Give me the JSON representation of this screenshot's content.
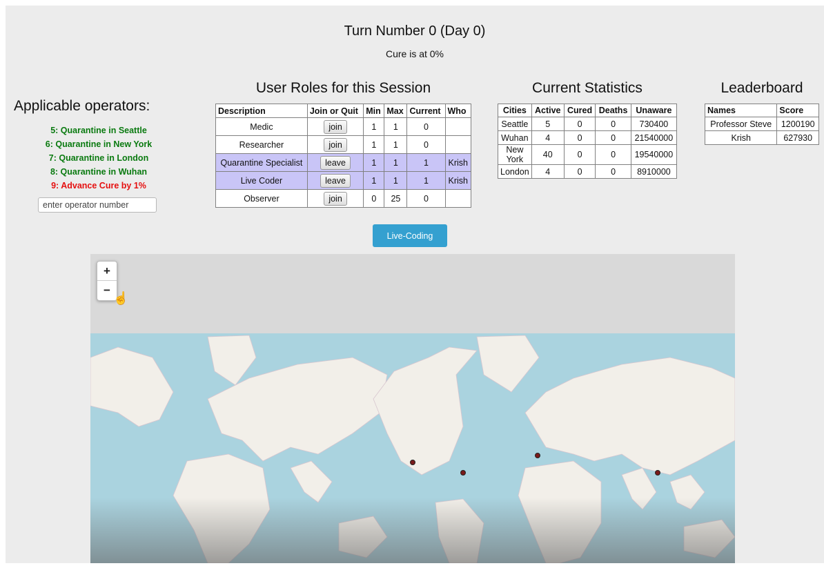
{
  "header": {
    "turn": "Turn Number 0 (Day 0)",
    "cure": "Cure is at 0%"
  },
  "operators": {
    "title": "Applicable operators:",
    "items": [
      {
        "label": "5: Quarantine in Seattle",
        "color": "#0a7a10"
      },
      {
        "label": "6: Quarantine in New York",
        "color": "#0a7a10"
      },
      {
        "label": "7: Quarantine in London",
        "color": "#0a7a10"
      },
      {
        "label": "8: Quarantine in Wuhan",
        "color": "#0a7a10"
      },
      {
        "label": "9: Advance Cure by 1%",
        "color": "#e51010"
      }
    ],
    "input_placeholder": "enter operator number"
  },
  "roles": {
    "title": "User Roles for this Session",
    "headers": [
      "Description",
      "Join or Quit",
      "Min",
      "Max",
      "Current",
      "Who"
    ],
    "rows": [
      {
        "description": "Medic",
        "action": "join",
        "min": "1",
        "max": "1",
        "current": "0",
        "who": ""
      },
      {
        "description": "Researcher",
        "action": "join",
        "min": "1",
        "max": "1",
        "current": "0",
        "who": ""
      },
      {
        "description": "Quarantine Specialist",
        "action": "leave",
        "min": "1",
        "max": "1",
        "current": "1",
        "who": "Krish"
      },
      {
        "description": "Live Coder",
        "action": "leave",
        "min": "1",
        "max": "1",
        "current": "1",
        "who": "Krish"
      },
      {
        "description": "Observer",
        "action": "join",
        "min": "0",
        "max": "25",
        "current": "0",
        "who": ""
      }
    ]
  },
  "stats": {
    "title": "Current Statistics",
    "headers": [
      "Cities",
      "Active",
      "Cured",
      "Deaths",
      "Unaware"
    ],
    "rows": [
      {
        "city": "Seattle",
        "active": "5",
        "cured": "0",
        "deaths": "0",
        "unaware": "730400"
      },
      {
        "city": "Wuhan",
        "active": "4",
        "cured": "0",
        "deaths": "0",
        "unaware": "21540000"
      },
      {
        "city": "New York",
        "active": "40",
        "cured": "0",
        "deaths": "0",
        "unaware": "19540000"
      },
      {
        "city": "London",
        "active": "4",
        "cured": "0",
        "deaths": "0",
        "unaware": "8910000"
      }
    ]
  },
  "leaderboard": {
    "title": "Leaderboard",
    "headers": [
      "Names",
      "Score"
    ],
    "rows": [
      {
        "name": "Professor Steve",
        "score": "1200190"
      },
      {
        "name": "Krish",
        "score": "627930"
      }
    ]
  },
  "live_coding": {
    "label": "Live-Coding"
  },
  "map": {
    "zoom_in": "+",
    "zoom_out": "−",
    "ocean_color": "#aad3df",
    "land_color": "#f2efe9",
    "marker_color": "#7a1a1a",
    "city_markers": [
      "Seattle",
      "New York",
      "London",
      "Wuhan"
    ]
  }
}
